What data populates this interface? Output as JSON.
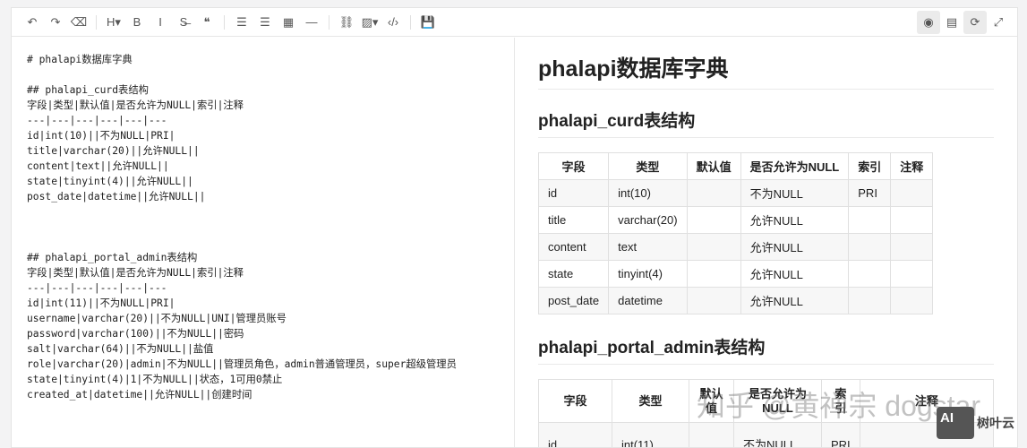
{
  "toolbar": {
    "left": [
      {
        "name": "undo-icon",
        "glyph": "↶"
      },
      {
        "name": "redo-icon",
        "glyph": "↷"
      },
      {
        "name": "eraser-icon",
        "glyph": "⌫"
      },
      {
        "sep": true
      },
      {
        "name": "heading-icon",
        "glyph": "H▾"
      },
      {
        "name": "bold-icon",
        "glyph": "B"
      },
      {
        "name": "italic-icon",
        "glyph": "I"
      },
      {
        "name": "strikethrough-icon",
        "glyph": "S̶"
      },
      {
        "name": "quote-icon",
        "glyph": "❝"
      },
      {
        "sep": true
      },
      {
        "name": "unordered-list-icon",
        "glyph": "☰"
      },
      {
        "name": "ordered-list-icon",
        "glyph": "☰"
      },
      {
        "name": "table-icon",
        "glyph": "▦"
      },
      {
        "name": "horizontal-rule-icon",
        "glyph": "—"
      },
      {
        "sep": true
      },
      {
        "name": "link-icon",
        "glyph": "⛓"
      },
      {
        "name": "image-icon",
        "glyph": "▨▾"
      },
      {
        "name": "code-icon",
        "glyph": "‹/›"
      },
      {
        "sep": true
      },
      {
        "name": "save-icon",
        "glyph": "💾"
      }
    ],
    "right": [
      {
        "name": "preview-icon",
        "glyph": "◉",
        "active": true
      },
      {
        "name": "layout-icon",
        "glyph": "▤"
      },
      {
        "name": "sync-scroll-icon",
        "glyph": "⟳",
        "active": true
      },
      {
        "name": "fullscreen-icon",
        "glyph": "⤢"
      }
    ]
  },
  "editor": {
    "content": "# phalapi数据库字典\n\n## phalapi_curd表结构\n字段|类型|默认值|是否允许为NULL|索引|注释\n---|---|---|---|---|---\nid|int(10)||不为NULL|PRI|\ntitle|varchar(20)||允许NULL||\ncontent|text||允许NULL||\nstate|tinyint(4)||允许NULL||\npost_date|datetime||允许NULL||\n\n\n\n## phalapi_portal_admin表结构\n字段|类型|默认值|是否允许为NULL|索引|注释\n---|---|---|---|---|---\nid|int(11)||不为NULL|PRI|\nusername|varchar(20)||不为NULL|UNI|管理员账号\npassword|varchar(100)||不为NULL||密码\nsalt|varchar(64)||不为NULL||盐值\nrole|varchar(20)|admin|不为NULL||管理员角色，admin普通管理员，super超级管理员\nstate|tinyint(4)|1|不为NULL||状态，1可用0禁止\ncreated_at|datetime||允许NULL||创建时间\n\n\n\n## phalapi_portal_admin_role表结构\n字段|类型|默认值|是否允许为NULL|索引|注释"
  },
  "preview": {
    "title": "phalapi数据库字典",
    "tables": [
      {
        "heading": "phalapi_curd表结构",
        "headers": [
          "字段",
          "类型",
          "默认值",
          "是否允许为NULL",
          "索引",
          "注释"
        ],
        "rows": [
          [
            "id",
            "int(10)",
            "",
            "不为NULL",
            "PRI",
            ""
          ],
          [
            "title",
            "varchar(20)",
            "",
            "允许NULL",
            "",
            ""
          ],
          [
            "content",
            "text",
            "",
            "允许NULL",
            "",
            ""
          ],
          [
            "state",
            "tinyint(4)",
            "",
            "允许NULL",
            "",
            ""
          ],
          [
            "post_date",
            "datetime",
            "",
            "允许NULL",
            "",
            ""
          ]
        ]
      },
      {
        "heading": "phalapi_portal_admin表结构",
        "headers": [
          "字段",
          "类型",
          "默认值",
          "是否允许为NULL",
          "索引",
          "注释"
        ],
        "rows": [
          [
            "id",
            "int(11)",
            "",
            "不为NULL",
            "PRI",
            ""
          ]
        ]
      }
    ]
  },
  "watermark": {
    "text": "知乎 @黄禅宗 dogstar",
    "logo_mark": "AI",
    "logo_text": "树叶云"
  }
}
